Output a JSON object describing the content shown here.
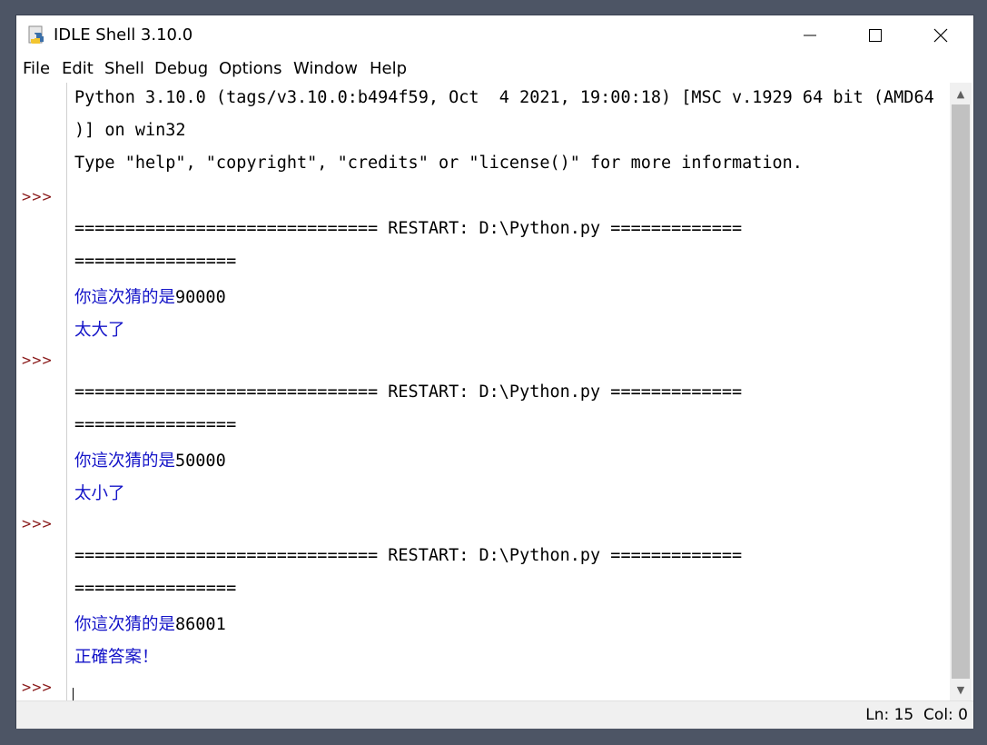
{
  "window": {
    "title": "IDLE Shell 3.10.0",
    "controls": [
      "minimize",
      "maximize",
      "close"
    ]
  },
  "menu": [
    "File",
    "Edit",
    "Shell",
    "Debug",
    "Options",
    "Window",
    "Help"
  ],
  "prompt_symbol": ">>>",
  "shell": {
    "banner_line1": "Python 3.10.0 (tags/v3.10.0:b494f59, Oct  4 2021, 19:00:18) [MSC v.1929 64 bit (AMD64",
    "banner_line2": ")] on win32",
    "banner_line3": "Type \"help\", \"copyright\", \"credits\" or \"license()\" for more information.",
    "restart_line1": "============================== RESTART: D:\\Python.py =============",
    "restart_line2": "================",
    "run1": {
      "guess_label": "你這次猜的是",
      "guess_value": "90000",
      "result": "太大了"
    },
    "run2": {
      "guess_label": "你這次猜的是",
      "guess_value": "50000",
      "result": "太小了"
    },
    "run3": {
      "guess_label": "你這次猜的是",
      "guess_value": "86001",
      "result": "正確答案！"
    }
  },
  "status": {
    "ln": "Ln: 15",
    "col": "Col: 0"
  },
  "colors": {
    "prompt": "#8b1c1c",
    "output": "#1515c8",
    "scroll_thumb": "#c1c1c1"
  }
}
